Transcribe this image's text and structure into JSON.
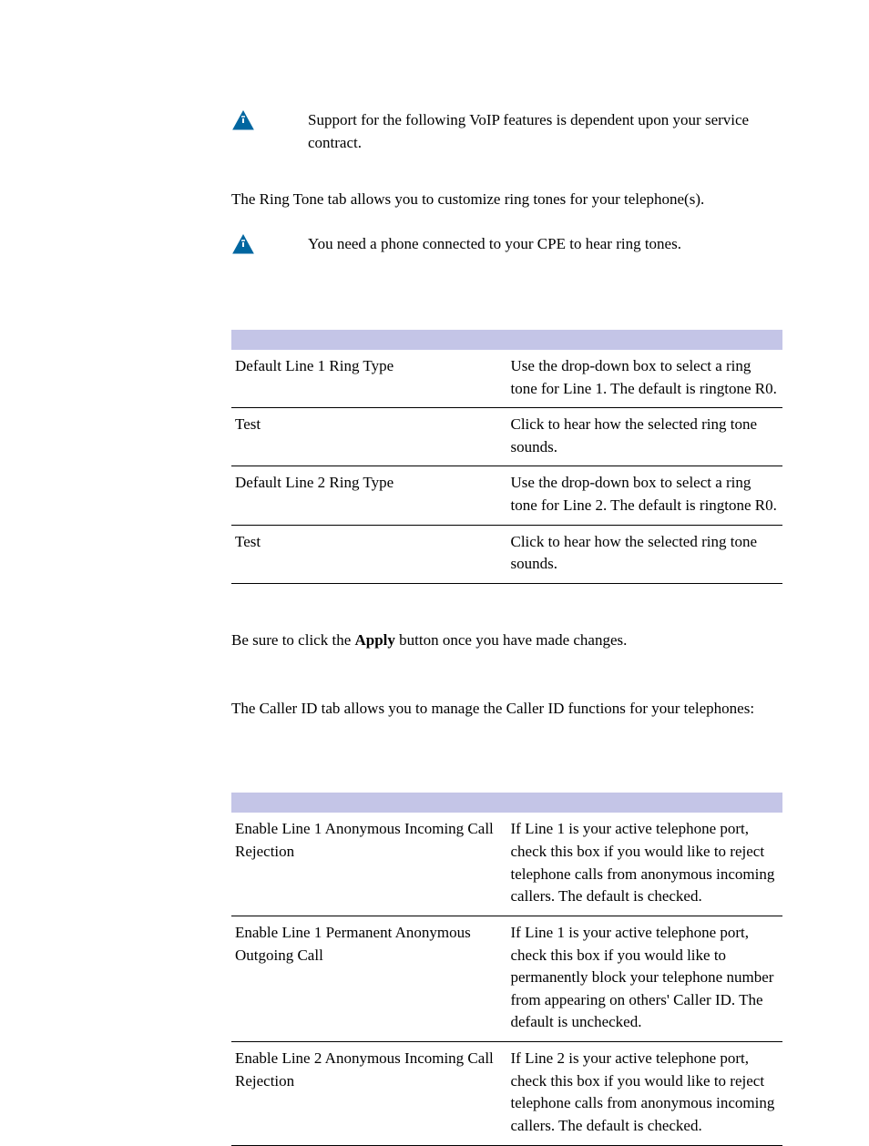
{
  "note1": "Support for the following VoIP features is dependent upon your service contract.",
  "intro1": "The Ring Tone tab allows you to customize ring tones for your telephone(s).",
  "note2": "You need a phone connected to your CPE to hear ring tones.",
  "table1": {
    "rows": [
      {
        "left": "Default Line 1 Ring Type",
        "right": "Use the drop-down box to select a ring tone for Line 1. The default is ringtone R0."
      },
      {
        "left": "Test",
        "right": "Click to hear how the selected ring tone sounds."
      },
      {
        "left": "Default Line 2 Ring Type",
        "right": "Use the drop-down box to select a ring tone for Line 2. The default is ringtone R0."
      },
      {
        "left": "Test",
        "right": "Click to hear how the selected ring tone sounds."
      }
    ]
  },
  "apply": {
    "prefix": "Be sure to click the ",
    "bold": "Apply",
    "suffix": " button once you have made changes."
  },
  "caller_intro": "The Caller ID tab allows you to manage the Caller ID functions for your telephones:",
  "table2": {
    "rows": [
      {
        "left": "Enable Line 1 Anonymous Incoming Call Rejection",
        "right": "If Line 1 is your active telephone port, check this box if you would like to reject telephone calls from anonymous incoming callers. The default is checked."
      },
      {
        "left": "Enable Line 1 Permanent Anonymous Outgoing Call",
        "right": "If Line 1 is your active telephone port, check this box if you would like to permanently block your telephone number from appearing on others' Caller ID. The default is unchecked."
      },
      {
        "left": "Enable Line 2 Anonymous Incoming Call Rejection",
        "right": "If Line 2 is your active telephone port, check this box if you would like to reject telephone calls from anonymous incoming callers. The default is checked."
      }
    ]
  }
}
